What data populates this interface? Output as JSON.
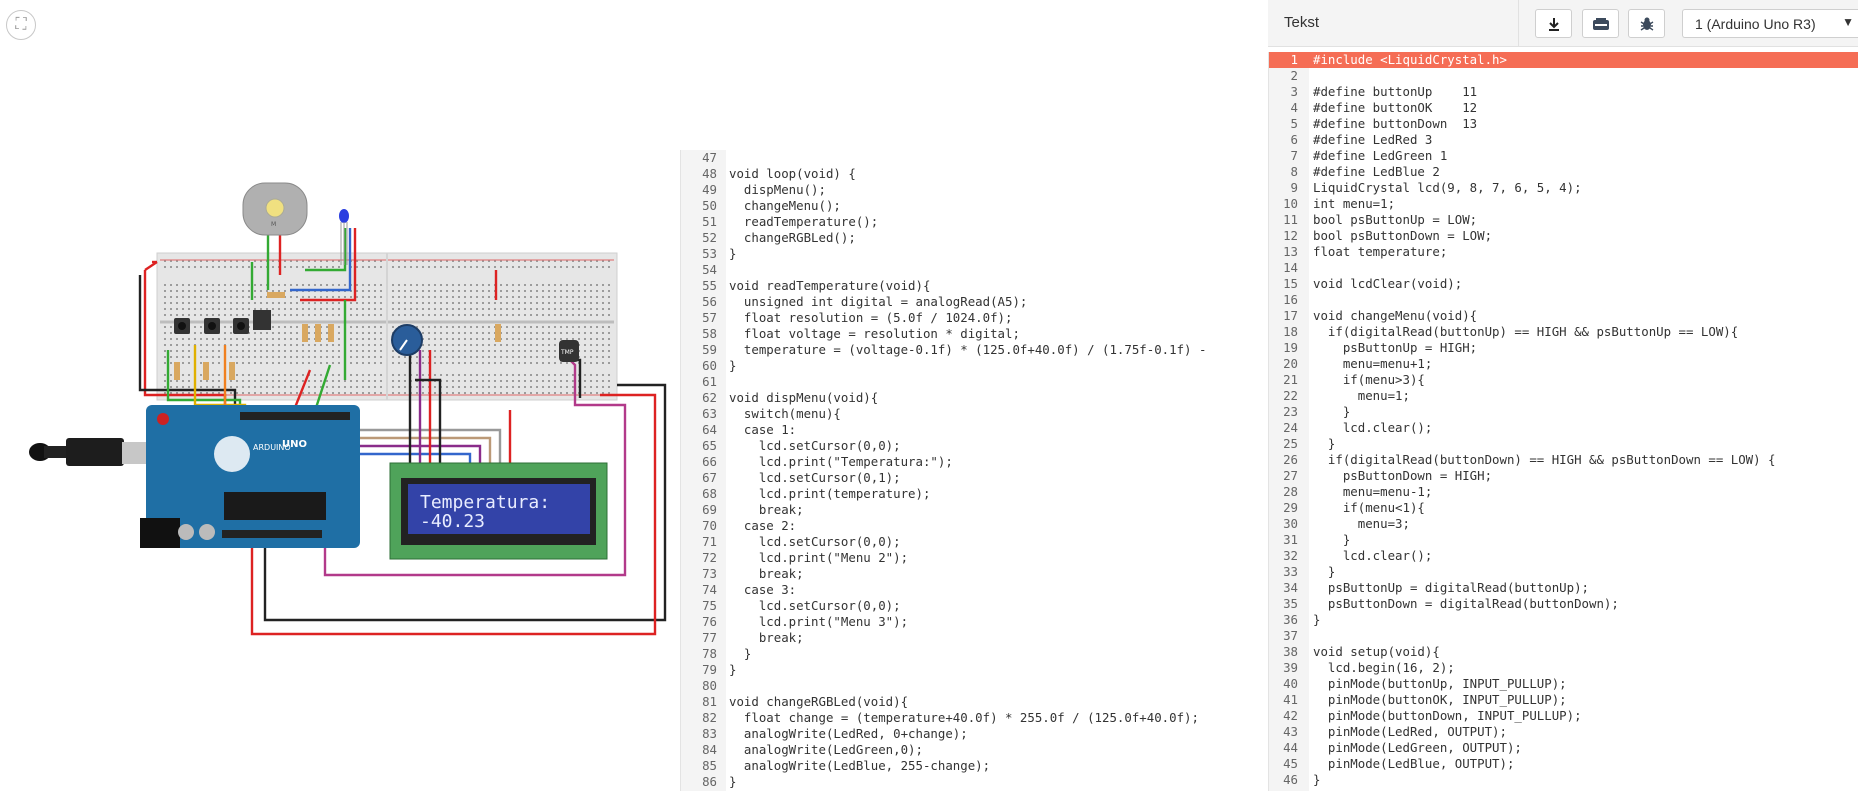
{
  "toolbar": {
    "mode_label": "Tekst",
    "download_icon": "download-icon",
    "library_icon": "components-icon",
    "debug_icon": "bug-icon",
    "board_select": "1 (Arduino Uno R3)"
  },
  "circuit": {
    "lcd_line1": "Temperatura:",
    "lcd_line2": "-40.23",
    "motor_label": "M",
    "board_label": "UNO",
    "board_brand": "ARDUINO",
    "sensor_label": "TMP"
  },
  "editor_mid": {
    "lines": [
      {
        "n": "47",
        "t": ""
      },
      {
        "n": "48",
        "t": "void loop(void) {"
      },
      {
        "n": "49",
        "t": "  dispMenu();"
      },
      {
        "n": "50",
        "t": "  changeMenu();"
      },
      {
        "n": "51",
        "t": "  readTemperature();"
      },
      {
        "n": "52",
        "t": "  changeRGBLed();"
      },
      {
        "n": "53",
        "t": "}"
      },
      {
        "n": "54",
        "t": ""
      },
      {
        "n": "55",
        "t": "void readTemperature(void){"
      },
      {
        "n": "56",
        "t": "  unsigned int digital = analogRead(A5);"
      },
      {
        "n": "57",
        "t": "  float resolution = (5.0f / 1024.0f);"
      },
      {
        "n": "58",
        "t": "  float voltage = resolution * digital;"
      },
      {
        "n": "59",
        "t": "  temperature = (voltage-0.1f) * (125.0f+40.0f) / (1.75f-0.1f) -"
      },
      {
        "n": "60",
        "t": "}"
      },
      {
        "n": "61",
        "t": ""
      },
      {
        "n": "62",
        "t": "void dispMenu(void){"
      },
      {
        "n": "63",
        "t": "  switch(menu){"
      },
      {
        "n": "64",
        "t": "  case 1:"
      },
      {
        "n": "65",
        "t": "    lcd.setCursor(0,0);"
      },
      {
        "n": "66",
        "t": "    lcd.print(\"Temperatura:\");"
      },
      {
        "n": "67",
        "t": "    lcd.setCursor(0,1);"
      },
      {
        "n": "68",
        "t": "    lcd.print(temperature);"
      },
      {
        "n": "69",
        "t": "    break;"
      },
      {
        "n": "70",
        "t": "  case 2:"
      },
      {
        "n": "71",
        "t": "    lcd.setCursor(0,0);"
      },
      {
        "n": "72",
        "t": "    lcd.print(\"Menu 2\");"
      },
      {
        "n": "73",
        "t": "    break;"
      },
      {
        "n": "74",
        "t": "  case 3:"
      },
      {
        "n": "75",
        "t": "    lcd.setCursor(0,0);"
      },
      {
        "n": "76",
        "t": "    lcd.print(\"Menu 3\");"
      },
      {
        "n": "77",
        "t": "    break;"
      },
      {
        "n": "78",
        "t": "  }"
      },
      {
        "n": "79",
        "t": "}"
      },
      {
        "n": "80",
        "t": ""
      },
      {
        "n": "81",
        "t": "void changeRGBLed(void){"
      },
      {
        "n": "82",
        "t": "  float change = (temperature+40.0f) * 255.0f / (125.0f+40.0f);"
      },
      {
        "n": "83",
        "t": "  analogWrite(LedRed, 0+change);"
      },
      {
        "n": "84",
        "t": "  analogWrite(LedGreen,0);"
      },
      {
        "n": "85",
        "t": "  analogWrite(LedBlue, 255-change);"
      },
      {
        "n": "86",
        "t": "}"
      }
    ]
  },
  "editor_right": {
    "lines": [
      {
        "n": "1",
        "t": "#include <LiquidCrystal.h>"
      },
      {
        "n": "2",
        "t": ""
      },
      {
        "n": "3",
        "t": "#define buttonUp    11"
      },
      {
        "n": "4",
        "t": "#define buttonOK    12"
      },
      {
        "n": "5",
        "t": "#define buttonDown  13"
      },
      {
        "n": "6",
        "t": "#define LedRed 3"
      },
      {
        "n": "7",
        "t": "#define LedGreen 1"
      },
      {
        "n": "8",
        "t": "#define LedBlue 2"
      },
      {
        "n": "9",
        "t": "LiquidCrystal lcd(9, 8, 7, 6, 5, 4);"
      },
      {
        "n": "10",
        "t": "int menu=1;"
      },
      {
        "n": "11",
        "t": "bool psButtonUp = LOW;"
      },
      {
        "n": "12",
        "t": "bool psButtonDown = LOW;"
      },
      {
        "n": "13",
        "t": "float temperature;"
      },
      {
        "n": "14",
        "t": ""
      },
      {
        "n": "15",
        "t": "void lcdClear(void);"
      },
      {
        "n": "16",
        "t": ""
      },
      {
        "n": "17",
        "t": "void changeMenu(void){"
      },
      {
        "n": "18",
        "t": "  if(digitalRead(buttonUp) == HIGH && psButtonUp == LOW){"
      },
      {
        "n": "19",
        "t": "    psButtonUp = HIGH;"
      },
      {
        "n": "20",
        "t": "    menu=menu+1;"
      },
      {
        "n": "21",
        "t": "    if(menu>3){"
      },
      {
        "n": "22",
        "t": "      menu=1;"
      },
      {
        "n": "23",
        "t": "    }"
      },
      {
        "n": "24",
        "t": "    lcd.clear();"
      },
      {
        "n": "25",
        "t": "  }"
      },
      {
        "n": "26",
        "t": "  if(digitalRead(buttonDown) == HIGH && psButtonDown == LOW) {"
      },
      {
        "n": "27",
        "t": "    psButtonDown = HIGH;"
      },
      {
        "n": "28",
        "t": "    menu=menu-1;"
      },
      {
        "n": "29",
        "t": "    if(menu<1){"
      },
      {
        "n": "30",
        "t": "      menu=3;"
      },
      {
        "n": "31",
        "t": "    }"
      },
      {
        "n": "32",
        "t": "    lcd.clear();"
      },
      {
        "n": "33",
        "t": "  }"
      },
      {
        "n": "34",
        "t": "  psButtonUp = digitalRead(buttonUp);"
      },
      {
        "n": "35",
        "t": "  psButtonDown = digitalRead(buttonDown);"
      },
      {
        "n": "36",
        "t": "}"
      },
      {
        "n": "37",
        "t": ""
      },
      {
        "n": "38",
        "t": "void setup(void){"
      },
      {
        "n": "39",
        "t": "  lcd.begin(16, 2);"
      },
      {
        "n": "40",
        "t": "  pinMode(buttonUp, INPUT_PULLUP);"
      },
      {
        "n": "41",
        "t": "  pinMode(buttonOK, INPUT_PULLUP);"
      },
      {
        "n": "42",
        "t": "  pinMode(buttonDown, INPUT_PULLUP);"
      },
      {
        "n": "43",
        "t": "  pinMode(LedRed, OUTPUT);"
      },
      {
        "n": "44",
        "t": "  pinMode(LedGreen, OUTPUT);"
      },
      {
        "n": "45",
        "t": "  pinMode(LedBlue, OUTPUT);"
      },
      {
        "n": "46",
        "t": "}"
      }
    ]
  },
  "colors": {
    "error_highlight": "#f56d55",
    "breadboard": "#e6e6e6",
    "arduino_board": "#1f6fa5",
    "lcd_frame": "#4fa35a",
    "lcd_screen": "#3343a8"
  }
}
